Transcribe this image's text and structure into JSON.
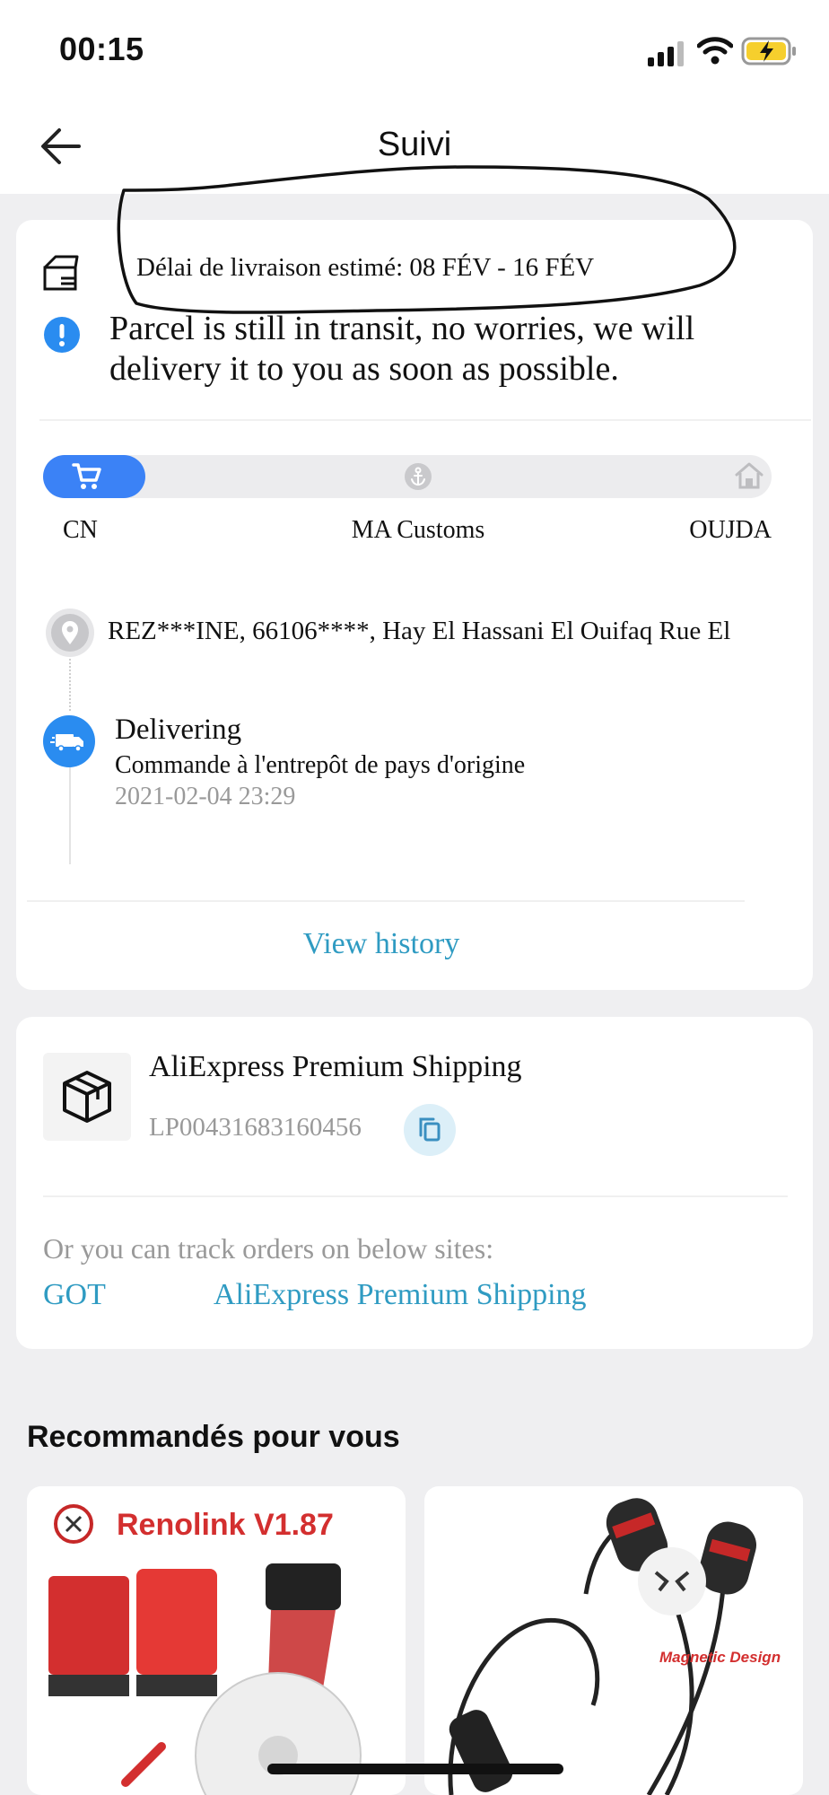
{
  "status_bar": {
    "time": "00:15"
  },
  "header": {
    "title": "Suivi"
  },
  "tracking": {
    "estimate": "Délai de livraison estimé: 08 FÉV - 16 FÉV",
    "notice": "Parcel is still in transit, no worries, we will delivery it to you as soon as possible.",
    "progress": {
      "fraction": 0.14
    },
    "stages": [
      "CN",
      "MA Customs",
      "OUJDA"
    ],
    "address": "REZ***INE,  66106****,  Hay El Hassani El Ouifaq Rue El",
    "latest_event": {
      "status": "Delivering",
      "description": "Commande à l'entrepôt de pays d'origine",
      "time": "2021-02-04 23:29"
    },
    "view_history_label": "View history"
  },
  "shipping": {
    "carrier": "AliExpress Premium Shipping",
    "tracking_number": "LP00431683160456",
    "track_hint": "Or you can track orders on below sites:",
    "sites": [
      "GOT",
      "AliExpress Premium Shipping"
    ]
  },
  "recommendations": {
    "title": "Recommandés pour vous",
    "products": [
      {
        "image_text": "Renolink V1.87"
      },
      {
        "image_text": "Magnetic Design"
      }
    ]
  },
  "colors": {
    "accent": "#2f9bc2",
    "progress": "#3b82f6",
    "page_bg": "#efeff1"
  }
}
